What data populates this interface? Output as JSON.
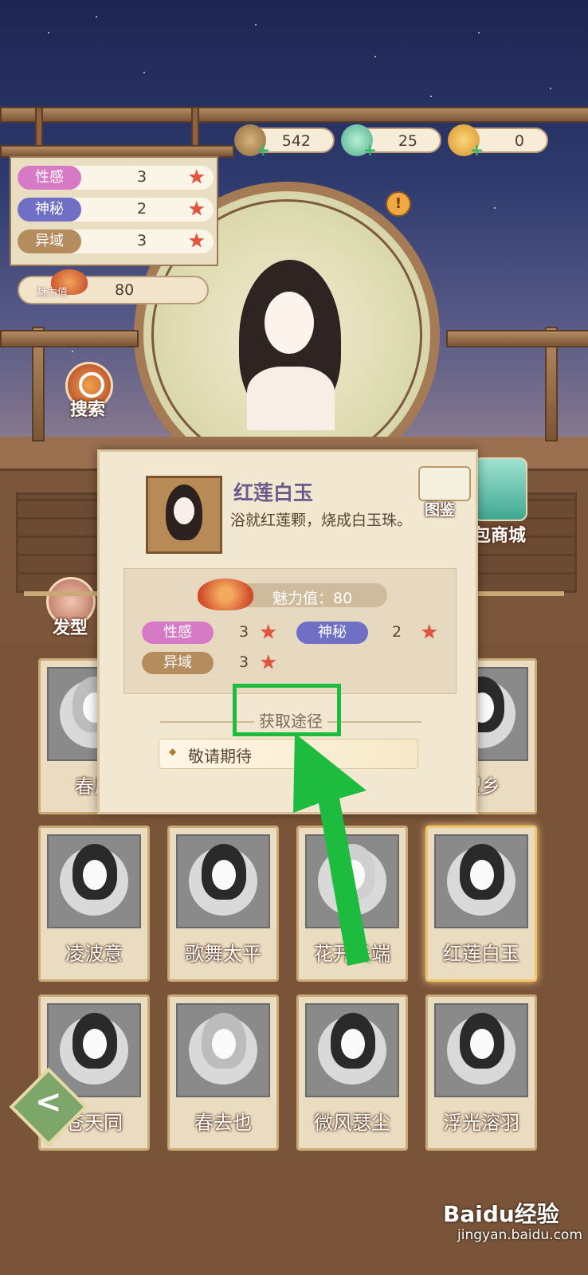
{
  "currency": [
    {
      "icon": "coin-icon",
      "value": "542"
    },
    {
      "icon": "jade-icon",
      "value": "25"
    },
    {
      "icon": "gold-coin-icon",
      "value": "0"
    }
  ],
  "stats": [
    {
      "label": "性感",
      "value": "3",
      "color": "#d77ac6"
    },
    {
      "label": "神秘",
      "value": "2",
      "color": "#6f6fc6"
    },
    {
      "label": "异域",
      "value": "3",
      "color": "#b58c5e"
    }
  ],
  "charm": {
    "label": "魅力值",
    "value": "80"
  },
  "buttons": {
    "search": "搜索",
    "hairstyle": "发型",
    "shop": "包商城"
  },
  "popup": {
    "title": "红莲白玉",
    "description": "浴就红莲颗，烧成白玉珠。",
    "atlas_label": "图鉴",
    "charm_label": "魅力值：80",
    "attributes": [
      {
        "label": "性感",
        "value": "3",
        "color": "#d77ac6"
      },
      {
        "label": "神秘",
        "value": "2",
        "color": "#6f6fc6"
      },
      {
        "label": "异域",
        "value": "3",
        "color": "#b58c5e"
      }
    ],
    "route_label": "获取途径",
    "route_item": "敬请期待"
  },
  "cards_row0": [
    "春风",
    "望乡"
  ],
  "cards": [
    {
      "name": "凌波意"
    },
    {
      "name": "歌舞太平"
    },
    {
      "name": "花开云端"
    },
    {
      "name": "红莲白玉",
      "selected": true
    },
    {
      "name": "苍天同"
    },
    {
      "name": "春去也"
    },
    {
      "name": "微风瑟尘"
    },
    {
      "name": "浮光溶羽"
    }
  ],
  "watermark": {
    "brand": "Baidu经验",
    "url": "jingyan.baidu.com"
  },
  "colors": {
    "highlight": "#1dbc3e",
    "accent_star": "#e5533d"
  }
}
